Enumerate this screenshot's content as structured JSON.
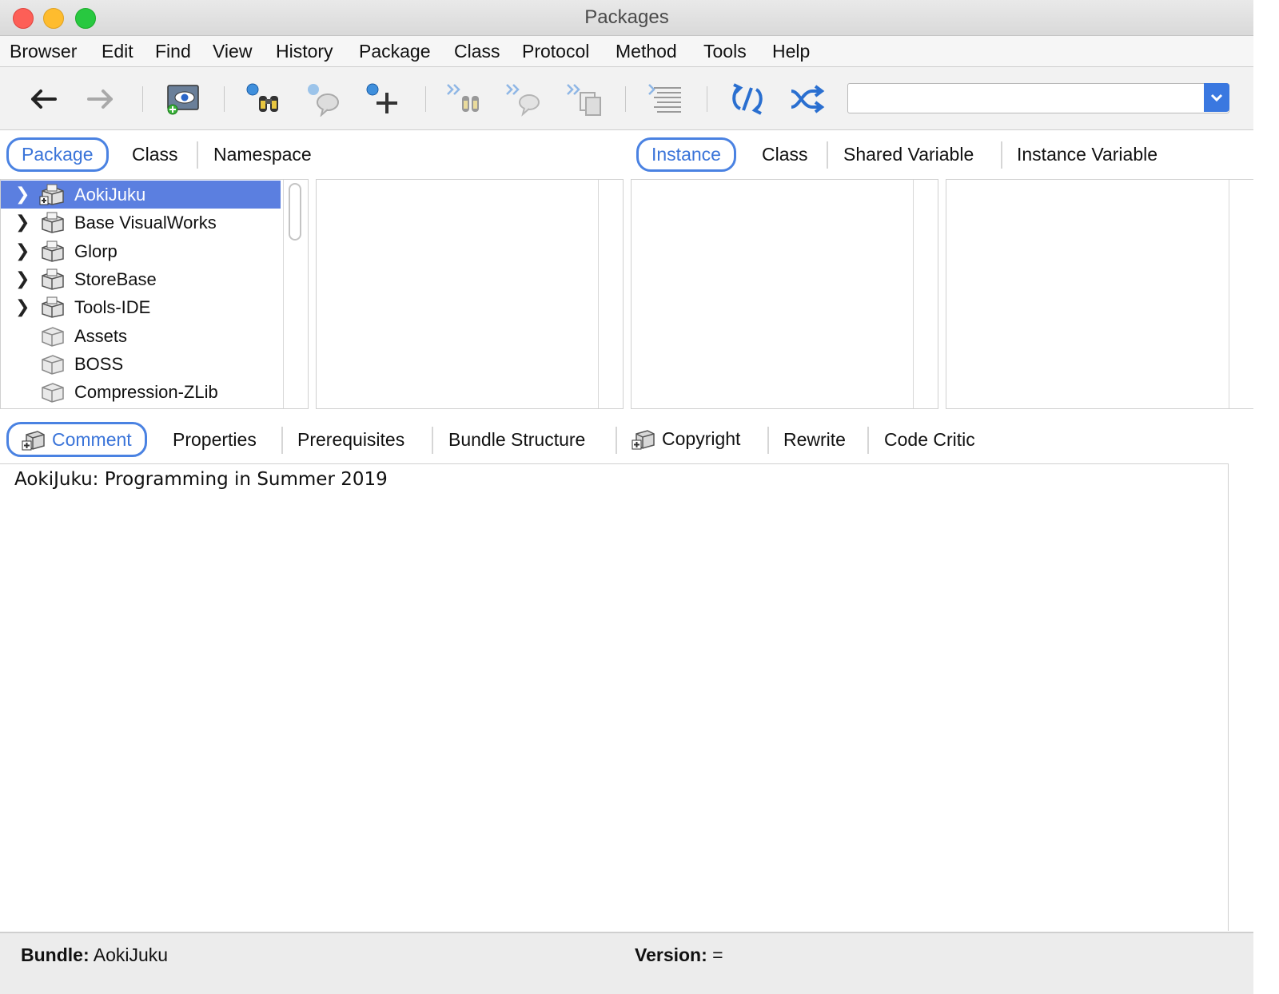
{
  "window": {
    "title": "Packages"
  },
  "menu": [
    "Browser",
    "Edit",
    "Find",
    "View",
    "History",
    "Package",
    "Class",
    "Protocol",
    "Method",
    "Tools",
    "Help"
  ],
  "toolbar": {
    "search_value": "",
    "icons": [
      "back-arrow-icon",
      "forward-arrow-icon",
      "visual-launcher-icon",
      "find-class-icon",
      "find-method-icon",
      "add-item-icon",
      "find-next-icon",
      "find-next-method-icon",
      "find-next-copy-icon",
      "format-icon",
      "refresh-icon",
      "shuffle-icon"
    ]
  },
  "left_tabs": {
    "package": "Package",
    "class": "Class",
    "namespace": "Namespace"
  },
  "right_tabs": {
    "instance": "Instance",
    "class": "Class",
    "shared_variable": "Shared Variable",
    "instance_variable": "Instance Variable"
  },
  "package_list": [
    {
      "label": "AokiJuku",
      "expandable": true,
      "selected": true
    },
    {
      "label": "Base VisualWorks",
      "expandable": true,
      "selected": false
    },
    {
      "label": "Glorp",
      "expandable": true,
      "selected": false
    },
    {
      "label": "StoreBase",
      "expandable": true,
      "selected": false
    },
    {
      "label": "Tools-IDE",
      "expandable": true,
      "selected": false
    },
    {
      "label": "Assets",
      "expandable": false,
      "selected": false
    },
    {
      "label": "BOSS",
      "expandable": false,
      "selected": false
    },
    {
      "label": "Compression-ZLib",
      "expandable": false,
      "selected": false
    }
  ],
  "bottom_tabs": {
    "comment": "Comment",
    "properties": "Properties",
    "prerequisites": "Prerequisites",
    "bundle_structure": "Bundle Structure",
    "copyright": "Copyright",
    "rewrite": "Rewrite",
    "code_critic": "Code Critic"
  },
  "editor": {
    "text": "AokiJuku: Programming in Summer 2019"
  },
  "status": {
    "bundle_label": "Bundle:",
    "bundle_value": "AokiJuku",
    "version_label": "Version:",
    "version_value": "="
  },
  "colors": {
    "accent": "#3a74d9",
    "selection": "#5b7fe0"
  }
}
